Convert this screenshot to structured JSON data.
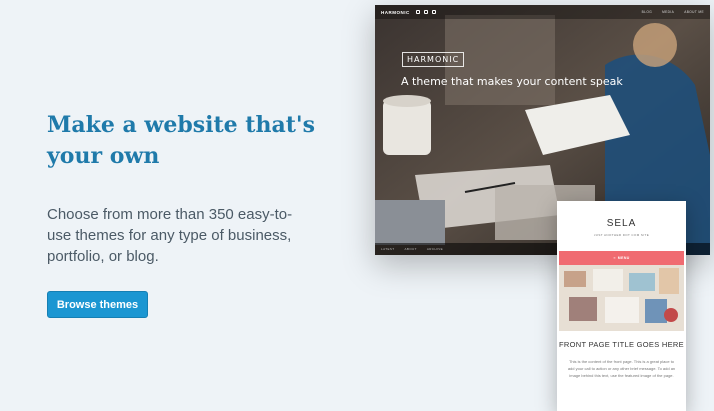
{
  "hero": {
    "headline": "Make a website that's your own",
    "subcopy": "Choose from more than 350 easy-to-use themes for any type of business, portfolio, or blog.",
    "button_label": "Browse themes"
  },
  "desktop_theme": {
    "brand": "HARMONIC",
    "top_nav": [
      "BLOG",
      "MEDIA",
      "ABOUT ME"
    ],
    "logo_box": "HARMONIC",
    "tagline": "A theme that makes your content speak",
    "bottom_nav": [
      "LATEST",
      "ABOUT",
      "ARCHIVE"
    ]
  },
  "mobile_theme": {
    "title": "SELA",
    "subtitle": "JUST ANOTHER DOT COM SITE",
    "menu_label": "MENU",
    "page_title": "FRONT PAGE TITLE GOES HERE",
    "page_text": "This is the content of the front page. This is a great place to add your call to action or any other brief message. To add an image behind this text, use the featured image of the page."
  },
  "colors": {
    "background": "#eef3f7",
    "headline": "#1f7aaa",
    "button": "#1b96d2",
    "menu_bar": "#f06b71"
  }
}
